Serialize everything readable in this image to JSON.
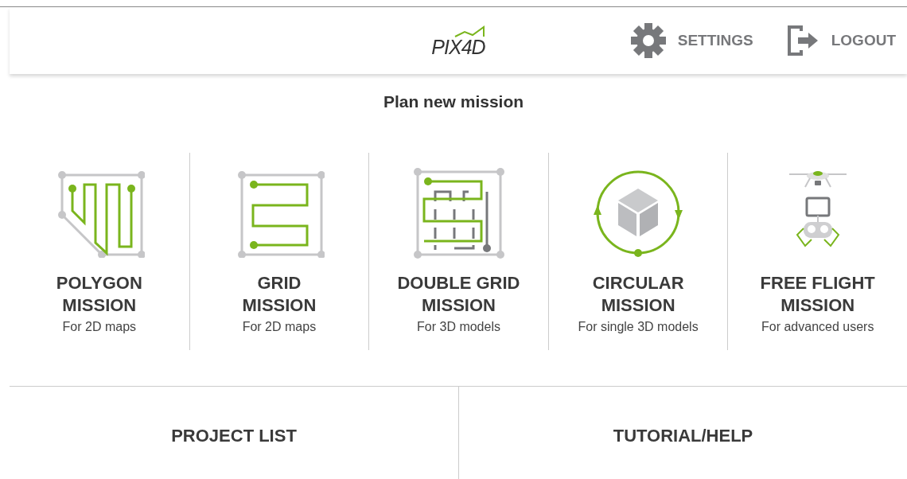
{
  "header": {
    "logo": "PIX4D",
    "actions": [
      {
        "kind": "settings",
        "label": "SETTINGS"
      },
      {
        "kind": "logout",
        "label": "LOGOUT"
      }
    ]
  },
  "title": "Plan new mission",
  "missions": [
    {
      "kind": "polygon",
      "name": [
        "POLYGON",
        "MISSION"
      ],
      "subtitle": "For 2D maps"
    },
    {
      "kind": "grid",
      "name": [
        "GRID",
        "MISSION"
      ],
      "subtitle": "For 2D maps"
    },
    {
      "kind": "double_grid",
      "name": [
        "DOUBLE GRID",
        "MISSION"
      ],
      "subtitle": "For 3D models"
    },
    {
      "kind": "circular",
      "name": [
        "CIRCULAR",
        "MISSION"
      ],
      "subtitle": "For single 3D models"
    },
    {
      "kind": "free_flight",
      "name": [
        "FREE FLIGHT",
        "MISSION"
      ],
      "subtitle": "For advanced users"
    }
  ],
  "bottom_buttons": [
    "PROJECT LIST",
    "TUTORIAL/HELP"
  ]
}
